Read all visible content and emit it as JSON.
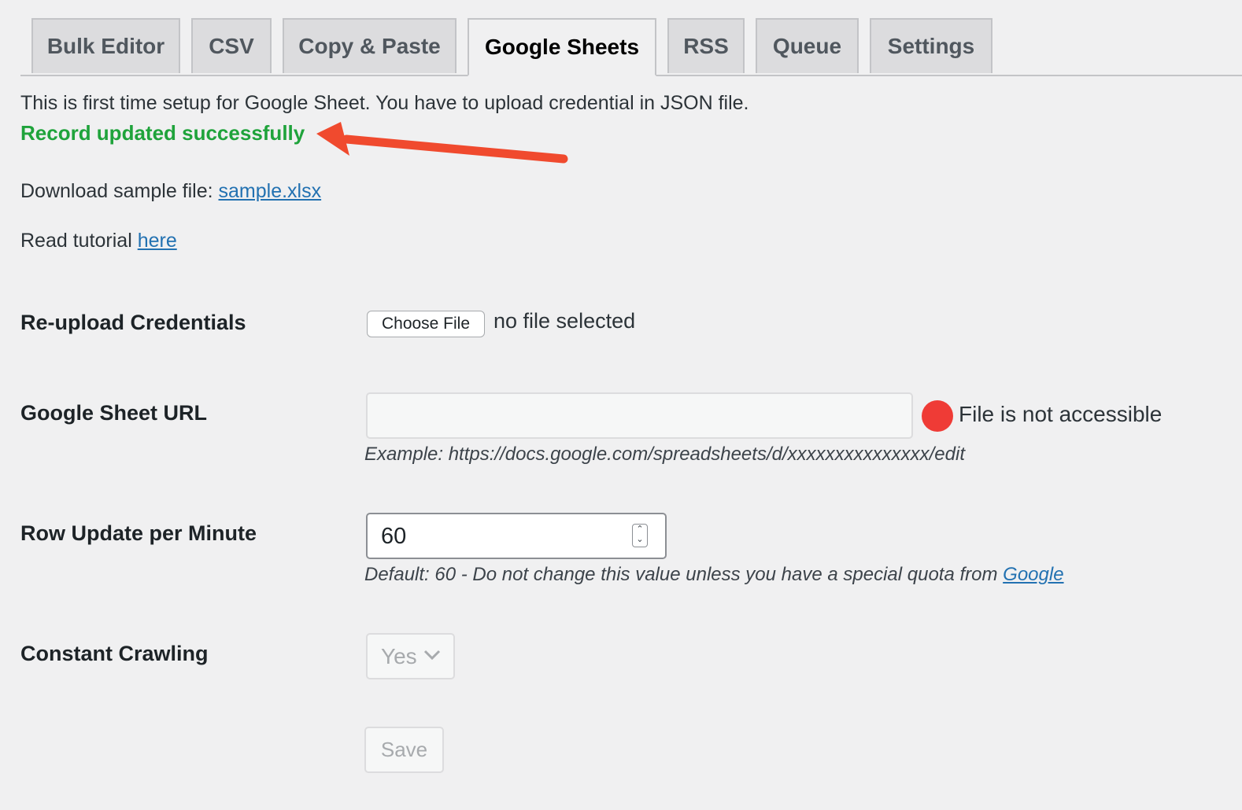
{
  "tabs": [
    {
      "label": "Bulk Editor",
      "active": false
    },
    {
      "label": "CSV",
      "active": false
    },
    {
      "label": "Copy & Paste",
      "active": false
    },
    {
      "label": "Google Sheets",
      "active": true
    },
    {
      "label": "RSS",
      "active": false
    },
    {
      "label": "Queue",
      "active": false
    },
    {
      "label": "Settings",
      "active": false
    }
  ],
  "notice": {
    "intro": "This is first time setup for Google Sheet. You have to upload credential in JSON file.",
    "success": "Record updated successfully",
    "success_color": "#1fa33b",
    "annotation_arrow_color": "#f04a2e"
  },
  "download": {
    "prefix": "Download sample file: ",
    "link": "sample.xlsx"
  },
  "tutorial": {
    "prefix": "Read tutorial ",
    "link": "here"
  },
  "form": {
    "credentials": {
      "label": "Re-upload Credentials",
      "button": "Choose File",
      "status": "no file selected"
    },
    "sheet_url": {
      "label": "Google Sheet URL",
      "value": "",
      "status": "File is not accessible",
      "status_color": "#ef3b36",
      "hint": "Example: https://docs.google.com/spreadsheets/d/xxxxxxxxxxxxxxx/edit"
    },
    "row_update": {
      "label": "Row Update per Minute",
      "value": "60",
      "hint_prefix": "Default: 60 - Do not change this value unless you have a special quota from ",
      "hint_link": "Google"
    },
    "crawling": {
      "label": "Constant Crawling",
      "selected": "Yes"
    },
    "save_label": "Save"
  }
}
